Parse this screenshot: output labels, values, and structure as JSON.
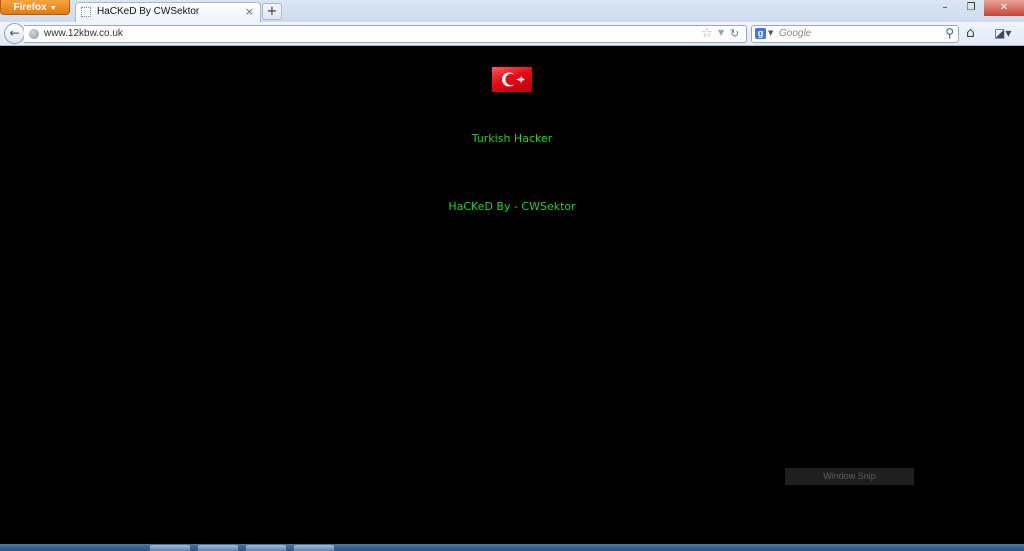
{
  "browser": {
    "menu_button": "Firefox",
    "tab": {
      "title": "HaCKeD By CWSektor"
    },
    "new_tab_label": "+",
    "url": "www.12kbw.co.uk",
    "search": {
      "engine": "Google",
      "placeholder": "Google"
    }
  },
  "page": {
    "background": "#000000",
    "text_color": "#1fd51f",
    "flag": "turkish-flag",
    "line1": "Turkish Hacker",
    "line2": "HaCKeD By - CWSektor"
  },
  "overlay": {
    "window_snip_label": "Window Snip"
  },
  "icons": {
    "back": "back-arrow-icon",
    "star": "bookmark-star-icon",
    "reload": "reload-icon",
    "home": "home-icon",
    "search": "magnifier-icon",
    "addons": "addon-bar-icon"
  }
}
